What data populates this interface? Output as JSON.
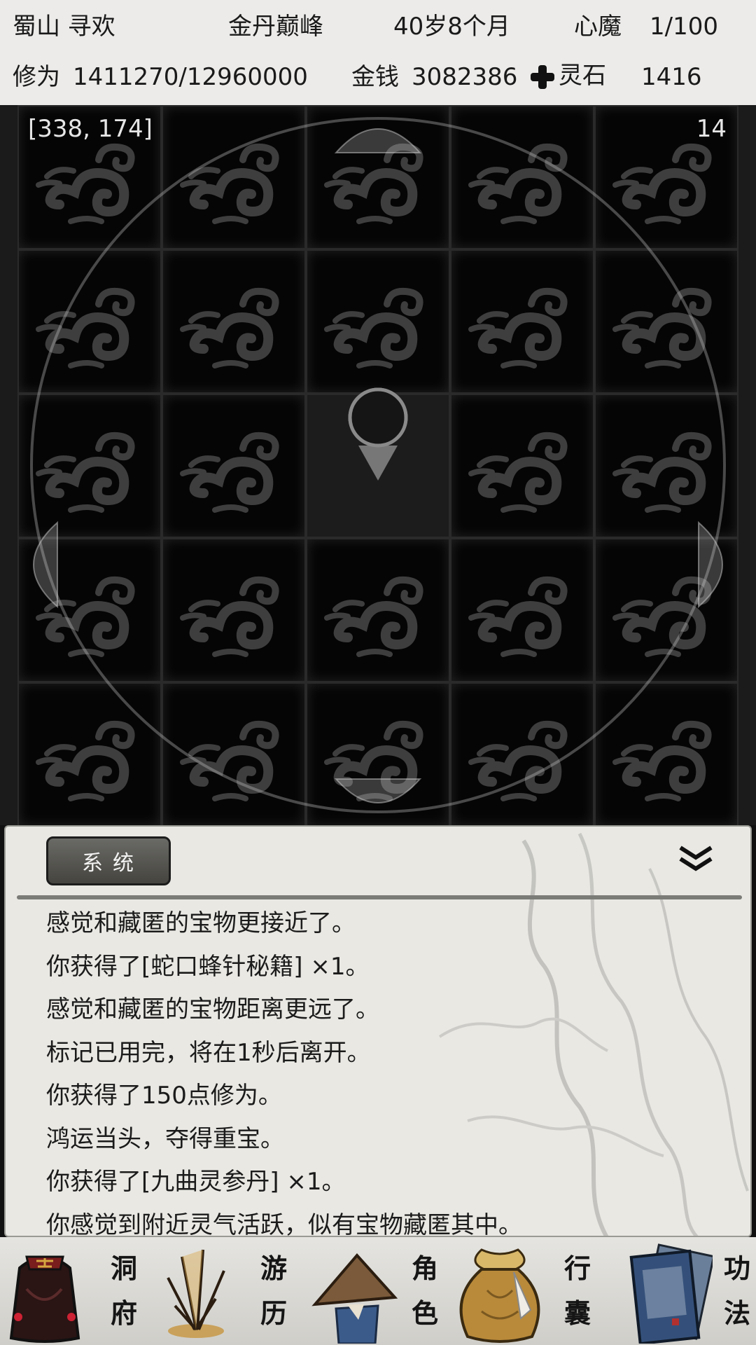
{
  "header": {
    "location": "蜀山 寻欢",
    "realm": "金丹巅峰",
    "age": "40岁8个月",
    "demon_label": "心魔",
    "demon_value": "1/100",
    "cultivation_label": "修为",
    "cultivation_value": "1411270/12960000",
    "money_label": "金钱",
    "money_value": "3082386",
    "spirit_stone_label": "灵石",
    "spirit_stone_value": "1416"
  },
  "map": {
    "coordinates": "[338, 174]",
    "steps_left": "14",
    "icons": {
      "tile": "cloud-swirl-icon",
      "player": "location-pin-icon"
    }
  },
  "log": {
    "tab_label": "系统",
    "messages": [
      "感觉和藏匿的宝物更接近了。",
      "你获得了[蛇口蜂针秘籍] ×1。",
      "感觉和藏匿的宝物距离更远了。",
      "标记已用完，将在1秒后离开。",
      "你获得了150点修为。",
      "鸿运当头，夺得重宝。",
      "你获得了[九曲灵参丹] ×1。",
      "你感觉到附近灵气活跃，似有宝物藏匿其中。"
    ]
  },
  "nav": [
    {
      "top": "洞",
      "bottom": "府",
      "icon": "cave-bag-icon"
    },
    {
      "top": "游",
      "bottom": "历",
      "icon": "grass-icon"
    },
    {
      "top": "角",
      "bottom": "色",
      "icon": "straw-hat-icon"
    },
    {
      "top": "行",
      "bottom": "囊",
      "icon": "pouch-icon"
    },
    {
      "top": "功",
      "bottom": "法",
      "icon": "scroll-book-icon"
    }
  ],
  "colors": {
    "header_bg": "#ecebe9",
    "map_bg": "#050505",
    "log_bg": "#e9e8e3",
    "tab_bg": "#55544f"
  }
}
